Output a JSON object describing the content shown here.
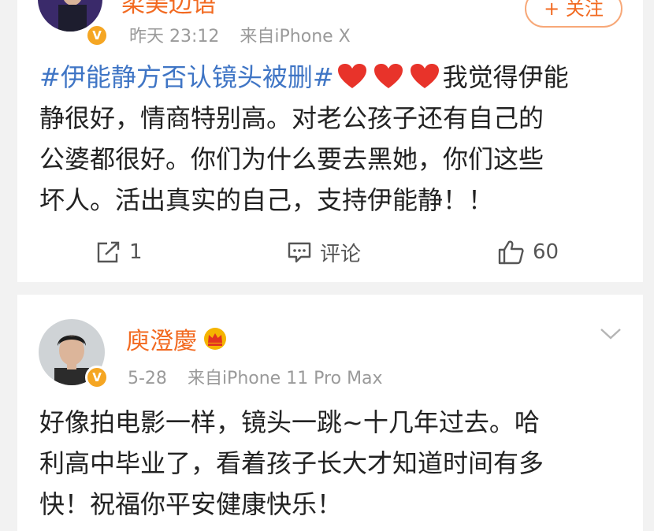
{
  "post1": {
    "username": "柔美边语",
    "timestamp": "昨天 23:12",
    "source": "来自iPhone X",
    "follow_label": "+ 关注",
    "hashtag": "#伊能静方否认镜头被删#",
    "text_after_hearts": "我觉得伊能",
    "lines": [
      "静很好，情商特别高。对老公孩子还有自己的",
      "公婆都很好。你们为什么要去黑她，你们这些",
      "坏人。活出真实的自己，支持伊能静！！"
    ],
    "repost_count": "1",
    "comment_label": "评论",
    "like_count": "60"
  },
  "post2": {
    "username": "庾澄慶",
    "timestamp": "5-28",
    "source": "来自iPhone 11 Pro Max",
    "lines": [
      "好像拍电影一样，镜头一跳~十几年过去。哈",
      "利高中毕业了，看着孩子长大才知道时间有多",
      "快！祝福你平安健康快乐！"
    ]
  },
  "colors": {
    "accent": "#f26a21",
    "hashtag": "#3f75c5",
    "heart": "#e8332a",
    "verified": "#f5a623"
  },
  "icons": [
    "repost-icon",
    "comment-icon",
    "like-icon",
    "heart-icon",
    "verified-badge-icon",
    "crown-icon",
    "chevron-down-icon"
  ]
}
